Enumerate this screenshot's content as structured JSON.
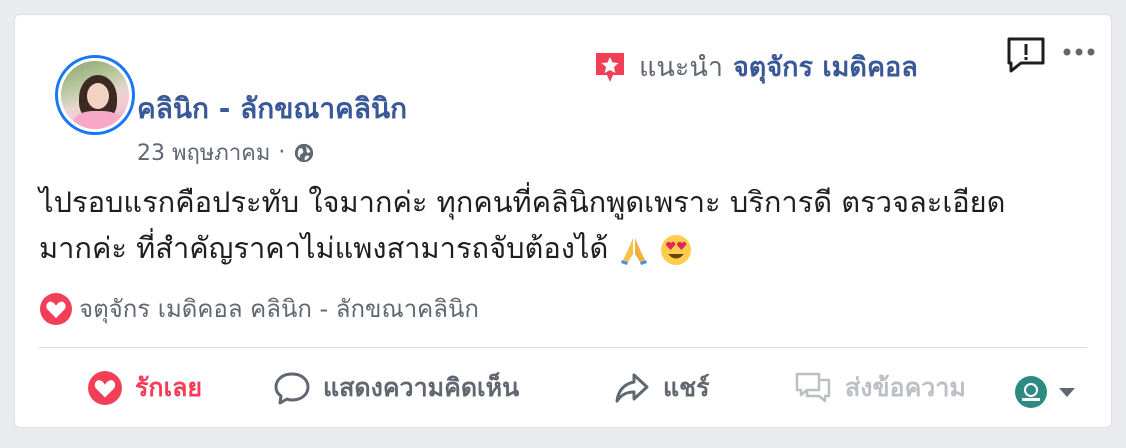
{
  "post": {
    "page_name": "คลินิก - ลักขณาคลินิก",
    "date": "23 พฤษภาคม",
    "separator": "·",
    "privacy_icon": "globe-icon",
    "recommendation": {
      "icon": "star-flag-icon",
      "verb": "แนะนำ",
      "target": "จตุจักร เมดิคอล"
    },
    "text_lines": [
      "ไปรอบแรกคือประทับ ใจมากค่ะ ทุกคนที่คลินิกพูดเพราะ บริการดี ตรวจละเอียด",
      "มากค่ะ ที่สำคัญราคาไม่แพงสามารถจับต้องได้"
    ],
    "emojis": [
      "folded-hands-icon",
      "heart-eyes-icon"
    ],
    "reactions": {
      "icon": "love-reaction-icon",
      "names": "จตุจักร เมดิคอล คลินิก - ลักขณาคลินิก"
    }
  },
  "actions": {
    "love_label": "รักเลย",
    "comment_label": "แสดงความคิดเห็น",
    "share_label": "แชร์",
    "message_label": "ส่งข้อความ"
  },
  "colors": {
    "link_blue": "#385898",
    "love_red": "#f33e58",
    "muted": "#606770",
    "disabled": "#bcc0c4"
  }
}
